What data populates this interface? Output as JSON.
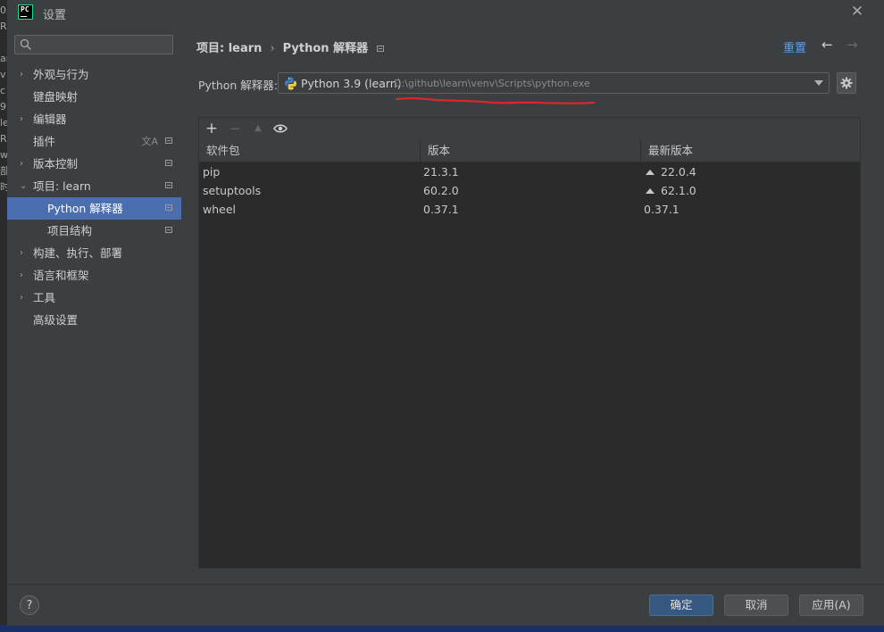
{
  "window": {
    "title": "设置",
    "app_logo_text": "PC"
  },
  "background_strip": [
    "0",
    "RE",
    "",
    "ar",
    "v",
    "c",
    "9",
    "le",
    "R",
    "w",
    "部",
    "时"
  ],
  "search": {
    "placeholder": "",
    "value": ""
  },
  "sidebar": {
    "items": [
      {
        "label": "外观与行为",
        "chevron": "›",
        "level": 0
      },
      {
        "label": "键盘映射",
        "chevron": "",
        "level": 0
      },
      {
        "label": "编辑器",
        "chevron": "›",
        "level": 0
      },
      {
        "label": "插件",
        "chevron": "",
        "level": 0,
        "translate_icon": "文A",
        "page_icon": true
      },
      {
        "label": "版本控制",
        "chevron": "›",
        "level": 0,
        "page_icon": true
      },
      {
        "label": "项目: learn",
        "chevron": "⌄",
        "level": 0,
        "page_icon": true
      },
      {
        "label": "Python 解释器",
        "chevron": "",
        "level": 1,
        "page_icon": true,
        "selected": true
      },
      {
        "label": "项目结构",
        "chevron": "",
        "level": 1,
        "page_icon": true
      },
      {
        "label": "构建、执行、部署",
        "chevron": "›",
        "level": 0
      },
      {
        "label": "语言和框架",
        "chevron": "›",
        "level": 0
      },
      {
        "label": "工具",
        "chevron": "›",
        "level": 0
      },
      {
        "label": "高级设置",
        "chevron": "",
        "level": 0
      }
    ]
  },
  "header": {
    "crumb_parent": "项目: learn",
    "crumb_separator": "›",
    "crumb_current": "Python 解释器",
    "reset_label": "重置"
  },
  "interpreter": {
    "label": "Python 解释器:",
    "name": "Python 3.9 (learn)",
    "path": "D:\\github\\learn\\venv\\Scripts\\python.exe"
  },
  "packages": {
    "toolbar": {
      "add": "+",
      "remove": "−",
      "upgrade": "▲"
    },
    "columns": [
      "软件包",
      "版本",
      "最新版本"
    ],
    "rows": [
      {
        "name": "pip",
        "version": "21.3.1",
        "latest": "22.0.4",
        "upgrade": true
      },
      {
        "name": "setuptools",
        "version": "60.2.0",
        "latest": "62.1.0",
        "upgrade": true
      },
      {
        "name": "wheel",
        "version": "0.37.1",
        "latest": "0.37.1",
        "upgrade": false
      }
    ]
  },
  "footer": {
    "help_label": "?",
    "ok_label": "确定",
    "cancel_label": "取消",
    "apply_label": "应用(A)"
  },
  "colors": {
    "accent": "#4b6eaf",
    "link": "#589df6",
    "annotation_red": "#e0242c",
    "background": "#3c3f41"
  }
}
